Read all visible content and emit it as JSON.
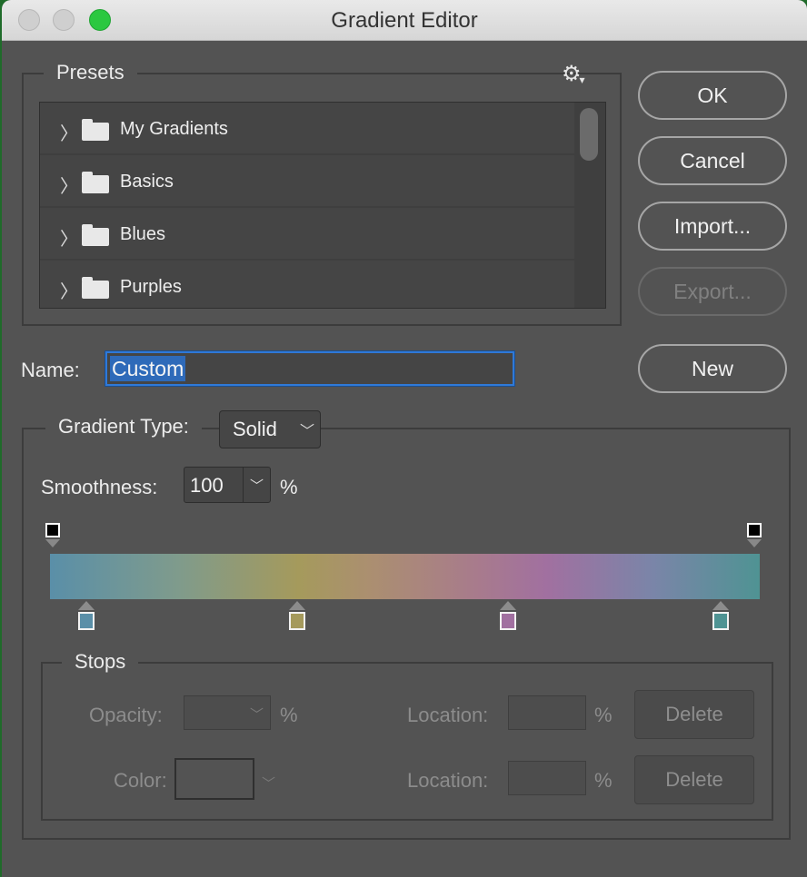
{
  "window": {
    "title": "Gradient Editor"
  },
  "presets": {
    "label": "Presets",
    "settings_icon": "gear-icon",
    "items": [
      {
        "label": "My Gradients",
        "icon": "folder-icon"
      },
      {
        "label": "Basics",
        "icon": "folder-icon"
      },
      {
        "label": "Blues",
        "icon": "folder-icon"
      },
      {
        "label": "Purples",
        "icon": "folder-icon"
      }
    ]
  },
  "buttons": {
    "ok": "OK",
    "cancel": "Cancel",
    "import": "Import...",
    "export": "Export...",
    "new": "New"
  },
  "name": {
    "label": "Name:",
    "value": "Custom"
  },
  "gradient": {
    "type_label": "Gradient Type:",
    "type_value": "Solid",
    "smoothness_label": "Smoothness:",
    "smoothness_value": "100",
    "smoothness_unit": "%",
    "opacity_stops": [
      {
        "location": 0,
        "color": "#000000"
      },
      {
        "location": 100,
        "color": "#000000"
      }
    ],
    "color_stops": [
      {
        "location": 0,
        "color": "#5a8fa8"
      },
      {
        "location": 35,
        "color": "#a59a5c"
      },
      {
        "location": 65,
        "color": "#a170a0"
      },
      {
        "location": 100,
        "color": "#4f9393"
      }
    ]
  },
  "stops": {
    "label": "Stops",
    "opacity_label": "Opacity:",
    "opacity_unit": "%",
    "location_label": "Location:",
    "location_unit": "%",
    "delete_label": "Delete",
    "color_label": "Color:"
  }
}
